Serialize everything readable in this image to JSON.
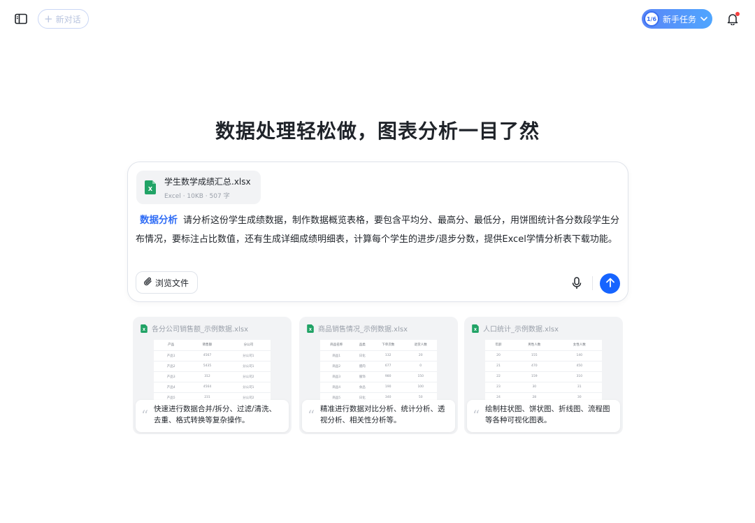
{
  "header": {
    "new_chat_label": "新对话",
    "task_counter": "1/6",
    "task_label": "新手任务"
  },
  "hero": {
    "title": "数据处理轻松做，图表分析一目了然"
  },
  "composer": {
    "attachment": {
      "name": "学生数学成绩汇总.xlsx",
      "info": "Excel · 10KB · 507 字"
    },
    "skill_tag": "数据分析",
    "prompt_text": "请分析这份学生成绩数据，制作数据概览表格，要包含平均分、最高分、最低分，用饼图统计各分数段学生分布情况，要标注占比数值，还有生成详细成绩明细表，计算每个学生的进步/退步分数，提供Excel学情分析表下载功能。",
    "browse_label": "浏览文件"
  },
  "examples": [
    {
      "file": "各分公司销售额_示例数据.xlsx",
      "headers": [
        "产品",
        "销售额",
        "分公司"
      ],
      "rows": [
        [
          "产品1",
          "4567",
          "分公司1"
        ],
        [
          "产品2",
          "5435",
          "分公司1"
        ],
        [
          "产品3",
          "312",
          "分公司2"
        ],
        [
          "产品4",
          "4564",
          "分公司1"
        ],
        [
          "产品5",
          "231",
          "分公司2"
        ]
      ],
      "description": "快速进行数据合并/拆分、过滤/清洗、去重、格式转换等复杂操作。"
    },
    {
      "file": "商品销售情况_示例数据.xlsx",
      "headers": [
        "商品名称",
        "品类",
        "下单次数",
        "退货人数"
      ],
      "rows": [
        [
          "商品1",
          "日化",
          "132",
          "20"
        ],
        [
          "商品2",
          "腊肉",
          "677",
          "0"
        ],
        [
          "商品3",
          "服饰",
          "980",
          "150"
        ],
        [
          "商品4",
          "食品",
          "190",
          "100"
        ],
        [
          "商品5",
          "日化",
          "340",
          "50"
        ]
      ],
      "description": "精准进行数据对比分析、统计分析、透视分析、相关性分析等。"
    },
    {
      "file": "人口统计_示例数据.xlsx",
      "headers": [
        "年龄",
        "男性人数",
        "女性人数"
      ],
      "rows": [
        [
          "20",
          "155",
          "140"
        ],
        [
          "21",
          "470",
          "450"
        ],
        [
          "22",
          "159",
          "310"
        ],
        [
          "23",
          "30",
          "31"
        ],
        [
          "24",
          "28",
          "30"
        ]
      ],
      "description": "绘制柱状图、饼状图、折线图、流程图等各种可视化图表。"
    }
  ],
  "colors": {
    "accent": "#1664ff",
    "tag": "#2f6cf5",
    "excel_green": "#21a366",
    "notification_dot": "#f53f3f"
  }
}
